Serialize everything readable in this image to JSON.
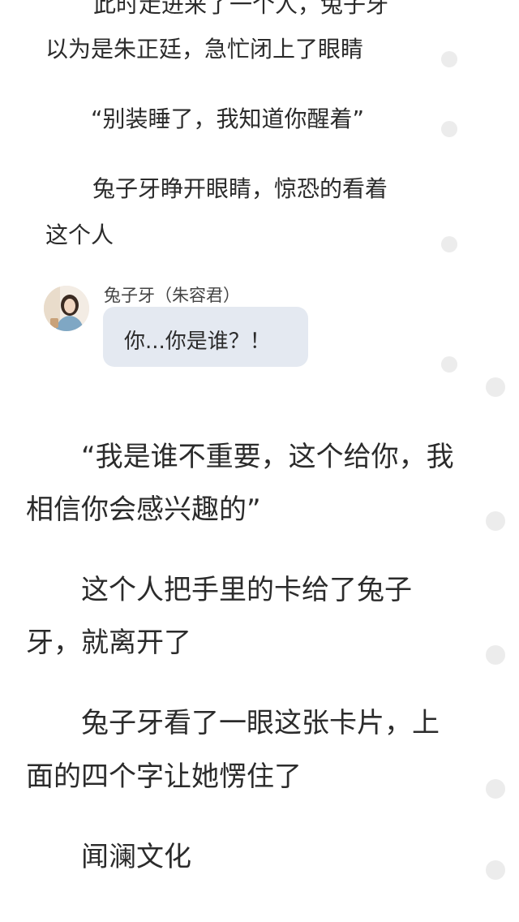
{
  "top_story": {
    "lines": [
      "此时走进来了一个人，兔子牙",
      "以为是朱正廷，急忙闭上了眼睛",
      "“别装睡了，我知道你醒着”",
      "兔子牙睁开眼睛，惊恐的看着",
      "这个人"
    ]
  },
  "dialogue": {
    "speaker": "兔子牙（朱容君）",
    "text": "你...你是谁？！"
  },
  "bottom_story": {
    "lines": [
      "“我是谁不重要，这个给你，我",
      "相信你会感兴趣的”",
      "这个人把手里的卡给了兔子",
      "牙，就离开了",
      "兔子牙看了一眼这张卡片，上",
      "面的四个字让她愣住了",
      "闻澜文化"
    ]
  }
}
